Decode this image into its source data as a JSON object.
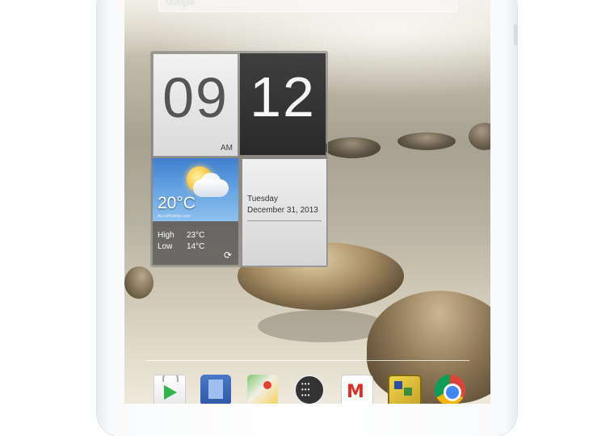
{
  "search": {
    "brand": "Google",
    "icon": "mic-icon"
  },
  "clock": {
    "hour": "09",
    "minute": "12",
    "ampm": "AM"
  },
  "weather": {
    "temperature": "20°C",
    "provider": "AccuWeather.com",
    "high_label": "High",
    "high_value": "23°C",
    "low_label": "Low",
    "low_value": "14°C",
    "refresh_icon": "refresh-icon"
  },
  "date": {
    "day_of_week": "Tuesday",
    "full_date": "December 31, 2013"
  },
  "dock": {
    "apps": [
      {
        "name": "Play Store",
        "icon": "play-store-icon"
      },
      {
        "name": "Docs",
        "icon": "docs-icon"
      },
      {
        "name": "Maps",
        "icon": "maps-icon"
      },
      {
        "name": "All Apps",
        "icon": "app-drawer-icon"
      },
      {
        "name": "Gmail",
        "icon": "gmail-icon"
      },
      {
        "name": "Game",
        "icon": "game-icon"
      },
      {
        "name": "Chrome",
        "icon": "chrome-icon"
      }
    ],
    "gmail_glyph": "M",
    "apps_glyph": "•••\n•••\n•••",
    "refresh_glyph": "⟳"
  },
  "colors": {
    "bezel": "#ffffff",
    "widget_bg": "#5f5f5f",
    "sky": "#4f8fd8",
    "accent": "#2fb34a"
  }
}
